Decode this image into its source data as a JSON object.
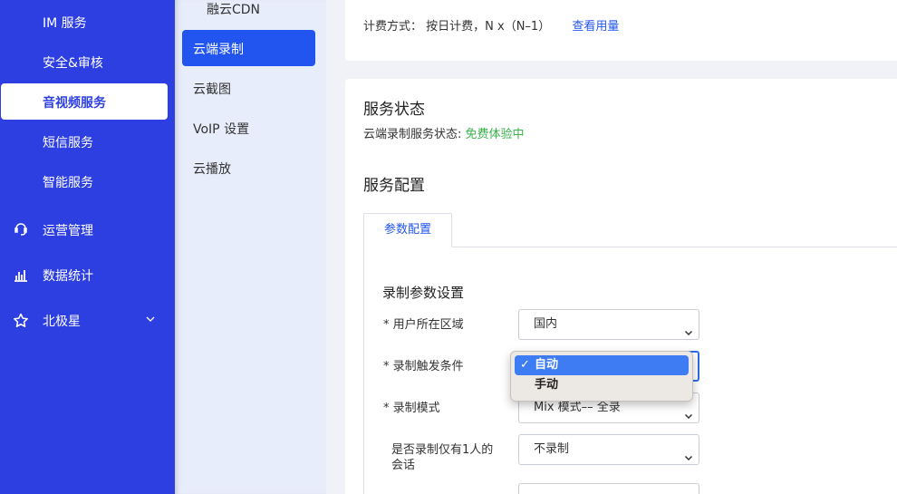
{
  "sidenav": {
    "sub_items": [
      "IM 服务",
      "安全&审核",
      "音视频服务",
      "短信服务",
      "智能服务"
    ],
    "active_sub": "音视频服务",
    "top_items": [
      {
        "label": "运营管理",
        "icon": "operations-icon"
      },
      {
        "label": "数据统计",
        "icon": "bar-chart-icon"
      },
      {
        "label": "北极星",
        "icon": "star-icon"
      }
    ]
  },
  "subnav": {
    "items": [
      "融云CDN",
      "云端录制",
      "云截图",
      "VoIP 设置",
      "云播放"
    ],
    "active": "云端录制"
  },
  "billing": {
    "label": "计费方式：",
    "value": "按日计费，N x（N–1）",
    "link": "查看用量"
  },
  "service_status": {
    "title": "服务状态",
    "label": "云端录制服务状态: ",
    "value": "免费体验中",
    "value_color": "#38b24a"
  },
  "service_config": {
    "title": "服务配置",
    "tab": "参数配置",
    "section_title": "录制参数设置",
    "fields": [
      {
        "label": "* 用户所在区域",
        "value": "国内"
      },
      {
        "label": "* 录制触发条件",
        "value": "自动"
      },
      {
        "label": "* 录制模式",
        "value": "Mix 模式–– 全录"
      },
      {
        "label": "是否录制仅有1人的会话",
        "value": "不录制"
      }
    ]
  },
  "dropdown": {
    "options": [
      "自动",
      "手动"
    ],
    "selected": "自动",
    "check": "✓"
  },
  "colors": {
    "primary": "#2d3fe0",
    "accent": "#2255f0",
    "success": "#38b24a"
  }
}
